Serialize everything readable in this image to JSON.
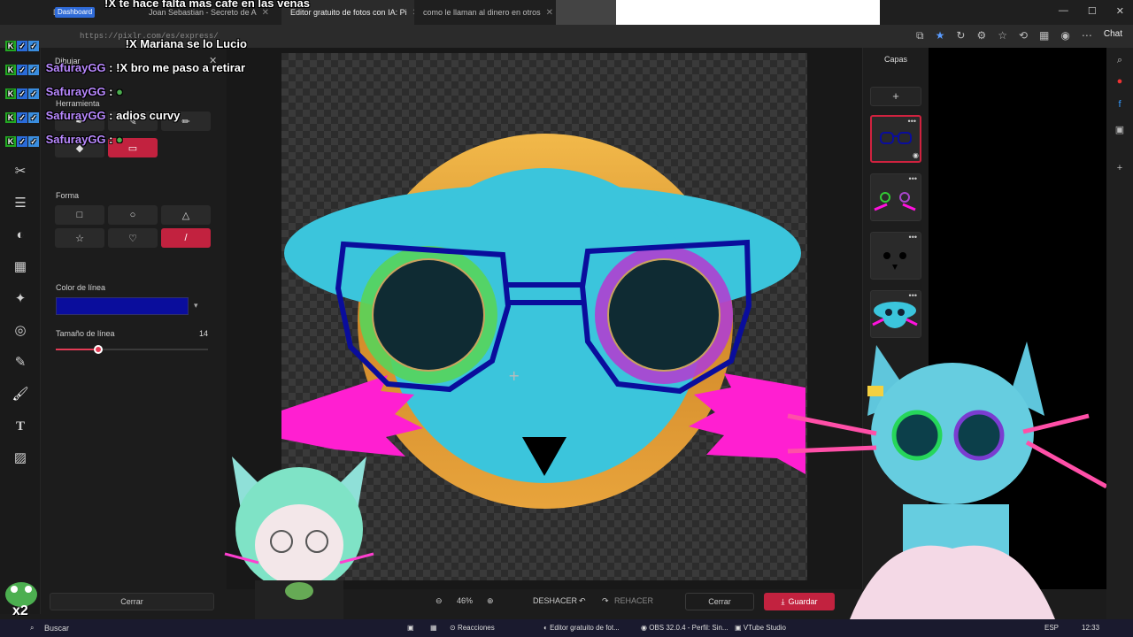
{
  "browser": {
    "tabs": [
      {
        "label": "Dashboard",
        "active": false
      },
      {
        "label": "Joan Sebastian - Secreto de A",
        "active": false
      },
      {
        "label": "Editor gratuito de fotos con IA: Pi",
        "active": true
      },
      {
        "label": "como le llaman al dinero en otros",
        "active": false
      }
    ],
    "url": "https://pixlr.com/es/express/",
    "chat_button": "Chat"
  },
  "chat_overlay": {
    "messages": [
      {
        "user": "",
        "text": "!X te hace falta mas cafe en las venas"
      },
      {
        "user": "",
        "text": "!X Mariana se lo Lucio"
      },
      {
        "user": "SafurayGG",
        "text": "!X bro me paso a retirar"
      },
      {
        "user": "SafurayGG",
        "text": ""
      },
      {
        "user": "SafurayGG",
        "text": "adios curvy"
      },
      {
        "user": "SafurayGG",
        "text": ""
      }
    ],
    "counter": "x2"
  },
  "panel": {
    "title": "Dibujar",
    "tool_label": "Herramienta",
    "shape_label": "Forma",
    "line_color_label": "Color de línea",
    "line_color": "#0a0d9c",
    "line_size_label": "Tamaño de línea",
    "line_size_value": "14",
    "line_size_fraction": 0.28,
    "close_label": "Cerrar"
  },
  "layers": {
    "title": "Capas",
    "add_label": "+"
  },
  "bottom": {
    "zoom": "46%",
    "undo": "DESHACER",
    "redo": "REHACER",
    "close": "Cerrar",
    "save": "Guardar"
  },
  "taskbar": {
    "search": "Buscar",
    "items": [
      "Reacciones",
      "Editor gratuito de fot...",
      "OBS 32.0.4 - Perfil: Sin...",
      "VTube Studio"
    ],
    "lang": "ESP",
    "time": "12:33"
  },
  "colors": {
    "accent": "#c2223f",
    "face": "#3bc5dc",
    "ring": "#e6a53a",
    "whiskers": "#ff1fd1",
    "glasses": "#0a0d9c"
  }
}
